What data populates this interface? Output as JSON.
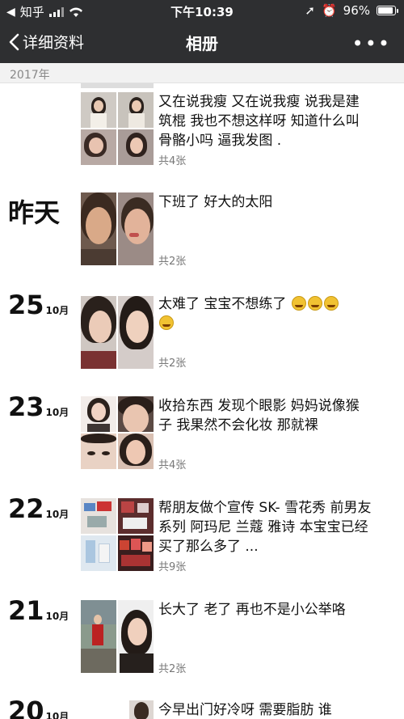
{
  "status_bar": {
    "carrier": "知乎",
    "time": "下午10:39",
    "battery": "96%",
    "battery_level": 0.96
  },
  "nav": {
    "back_label": "详细资料",
    "title": "相册",
    "more_label": "•••"
  },
  "year_header": "2017年",
  "posts": [
    {
      "date_text": "",
      "caption": "又在说我瘦 又在说我瘦  说我是建筑棍  我也不想这样呀 知道什么叫骨骼小吗  逼我发图 .",
      "count": "共4张"
    },
    {
      "date_text": "昨天",
      "caption": "下班了  好大的太阳",
      "count": "共2张"
    },
    {
      "day": "25",
      "month": "10月",
      "caption": "太难了  宝宝不想练了",
      "emoji_count": 4,
      "count": "共2张"
    },
    {
      "day": "23",
      "month": "10月",
      "caption": "收拾东西  发现个眼影  妈妈说像猴子  我果然不会化妆  那就裸",
      "count": "共4张"
    },
    {
      "day": "22",
      "month": "10月",
      "caption": "帮朋友做个宣传  SK-    雪花秀   前男友系列  阿玛尼  兰蔻  雅诗  本宝宝已经买了那么多了  ...",
      "count": "共9张"
    },
    {
      "day": "21",
      "month": "10月",
      "caption": "长大了   老了  再也不是小公举咯",
      "count": "共2张"
    },
    {
      "day": "20",
      "month": "10月",
      "caption": "今早出门好冷呀   需要脂肪  谁"
    }
  ]
}
